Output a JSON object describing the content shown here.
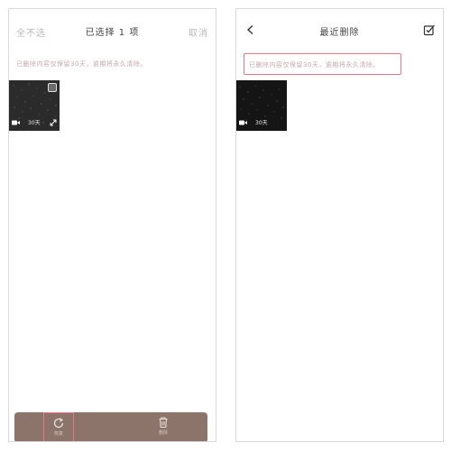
{
  "left_screen": {
    "header": {
      "deselect_all": "全不选",
      "selected_count": "已选择 1 项",
      "cancel": "取消"
    },
    "notice": "已删除内容仅保留30天，逾期将永久清除。",
    "item": {
      "duration": "30天",
      "selected": true
    },
    "bottom_bar": {
      "restore_label": "恢复",
      "delete_label": "删除"
    }
  },
  "right_screen": {
    "header": {
      "title": "最近删除"
    },
    "notice": "已删除内容仅保留30天，逾期将永久清除。",
    "item": {
      "duration": "30天"
    }
  },
  "colors": {
    "highlight": "#e67a84",
    "bottom_bar": "#8d746b",
    "notice_text": "#c7a8ae"
  }
}
